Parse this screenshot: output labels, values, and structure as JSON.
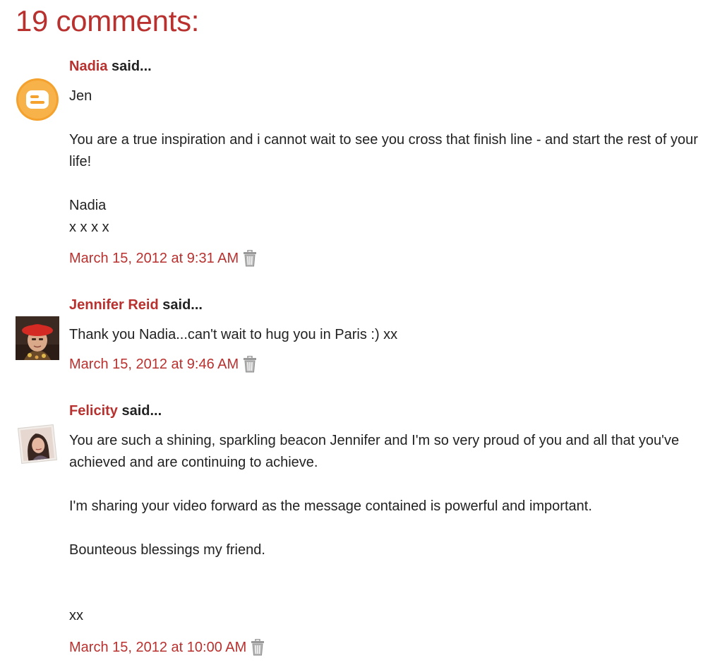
{
  "comments_heading": "19 comments:",
  "said_label": "said...",
  "delete_icon": "trash-icon",
  "comments": [
    {
      "author": "Nadia",
      "avatar": "blogger-logo-icon",
      "paragraphs": [
        "Jen",
        "",
        "You are a true inspiration and i cannot wait to see you cross that finish line - and start the rest of your life!",
        "",
        "Nadia",
        "x x x x"
      ],
      "timestamp": "March 15, 2012 at 9:31 AM"
    },
    {
      "author": "Jennifer Reid",
      "avatar": "user-photo-avatar",
      "paragraphs": [
        "Thank you Nadia...can't wait to hug you in Paris :) xx"
      ],
      "timestamp": "March 15, 2012 at 9:46 AM"
    },
    {
      "author": "Felicity",
      "avatar": "user-photo-avatar",
      "paragraphs": [
        "You are such a shining, sparkling beacon Jennifer and I'm so very proud of you and all that you've achieved and are continuing to achieve.",
        "",
        "I'm sharing your video forward as the message contained is powerful and important.",
        "",
        "Bounteous blessings my friend.",
        "",
        "",
        "xx"
      ],
      "timestamp": "March 15, 2012 at 10:00 AM"
    }
  ],
  "colors": {
    "accent": "#b8312f",
    "text": "#222222",
    "blogger_orange": "#f4a22d"
  }
}
